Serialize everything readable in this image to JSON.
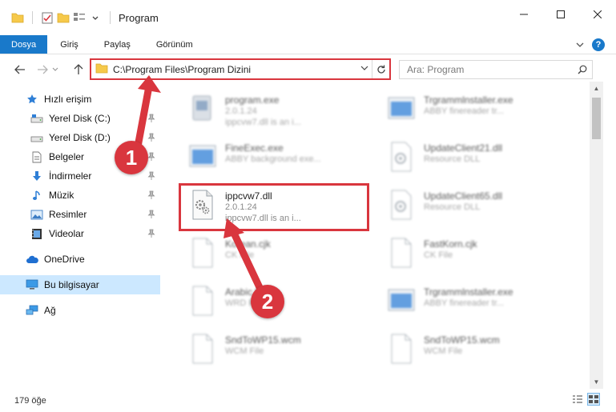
{
  "window": {
    "title": "Program",
    "controls": {
      "minimize": "minimize-icon",
      "maximize": "maximize-icon",
      "close": "close-icon"
    }
  },
  "ribbon": {
    "tabs": [
      {
        "label": "Dosya",
        "active": true
      },
      {
        "label": "Giriş",
        "active": false
      },
      {
        "label": "Paylaş",
        "active": false
      },
      {
        "label": "Görünüm",
        "active": false
      }
    ],
    "help": "?"
  },
  "address": {
    "path": "C:\\Program Files\\Program Dizini"
  },
  "search": {
    "placeholder": "Ara: Program"
  },
  "sidebar": {
    "items": [
      {
        "label": "Hızlı erişim",
        "icon": "star-icon",
        "pinned": false
      },
      {
        "label": "Yerel Disk (C:)",
        "icon": "drive-icon",
        "pinned": true
      },
      {
        "label": "Yerel Disk (D:)",
        "icon": "drive-icon",
        "pinned": true
      },
      {
        "label": "Belgeler",
        "icon": "documents-icon",
        "pinned": true
      },
      {
        "label": "İndirmeler",
        "icon": "download-icon",
        "pinned": true
      },
      {
        "label": "Müzik",
        "icon": "music-icon",
        "pinned": true
      },
      {
        "label": "Resimler",
        "icon": "pictures-icon",
        "pinned": true
      },
      {
        "label": "Videolar",
        "icon": "videos-icon",
        "pinned": true
      },
      {
        "label": "OneDrive",
        "icon": "cloud-icon",
        "pinned": false
      },
      {
        "label": "Bu bilgisayar",
        "icon": "computer-icon",
        "pinned": false,
        "selected": true
      },
      {
        "label": "Ağ",
        "icon": "network-icon",
        "pinned": false
      }
    ]
  },
  "files": [
    {
      "name": "program.exe",
      "line1": "2.0.1.24",
      "line2": "ippcvw7.dll is an i...",
      "icon": "exe-icon"
    },
    {
      "name": "Trgrammlnstaller.exe",
      "line1": "ABBY finereader tr...",
      "line2": "",
      "icon": "app-window-icon"
    },
    {
      "name": "FineExec.exe",
      "line1": "ABBY background exe...",
      "line2": "",
      "icon": "app-window-icon"
    },
    {
      "name": "UpdateClient21.dll",
      "line1": "Resource DLL",
      "line2": "",
      "icon": "dll-icon"
    },
    {
      "name": "ippcvw7.dll",
      "line1": "2.0.1.24",
      "line2": "ippcvw7.dll is an i...",
      "icon": "dll-gear-icon",
      "highlighted": true
    },
    {
      "name": "UpdateClient65.dll",
      "line1": "Resource DLL",
      "line2": "",
      "icon": "dll-icon"
    },
    {
      "name": "Korean.cjk",
      "line1": "CK File",
      "line2": "",
      "icon": "blank-file-icon"
    },
    {
      "name": "FastKorn.cjk",
      "line1": "CK File",
      "line2": "",
      "icon": "blank-file-icon"
    },
    {
      "name": "Arabic.lng",
      "line1": "WRD File",
      "line2": "",
      "icon": "blank-file-icon"
    },
    {
      "name": "Trgrammlnstaller.exe",
      "line1": "ABBY finereader tr...",
      "line2": "",
      "icon": "app-window-icon"
    },
    {
      "name": "SndToWP15.wcm",
      "line1": "WCM File",
      "line2": "",
      "icon": "blank-file-icon"
    },
    {
      "name": "SndToWP15.wcm",
      "line1": "WCM File",
      "line2": "",
      "icon": "blank-file-icon"
    }
  ],
  "status": {
    "item_count": "179 öğe"
  },
  "callouts": [
    "1",
    "2"
  ],
  "colors": {
    "accent": "#1979ca",
    "annotation_red": "#d9363e",
    "selected_bg": "#cce8ff"
  }
}
